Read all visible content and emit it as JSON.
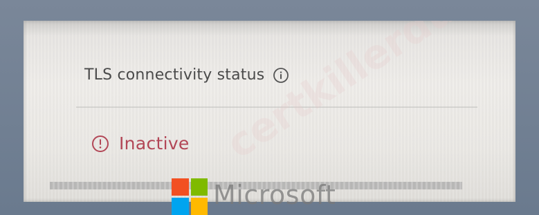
{
  "panel": {
    "title": "TLS connectivity status",
    "title_icon": "info-icon",
    "status_icon": "exclamation-circle-icon",
    "status_value": "Inactive",
    "status_color": "#b24656"
  },
  "watermark": {
    "text": "certkillerdumps.com"
  },
  "brand": {
    "logo_name": "microsoft-logo",
    "word": "Microsoft"
  }
}
